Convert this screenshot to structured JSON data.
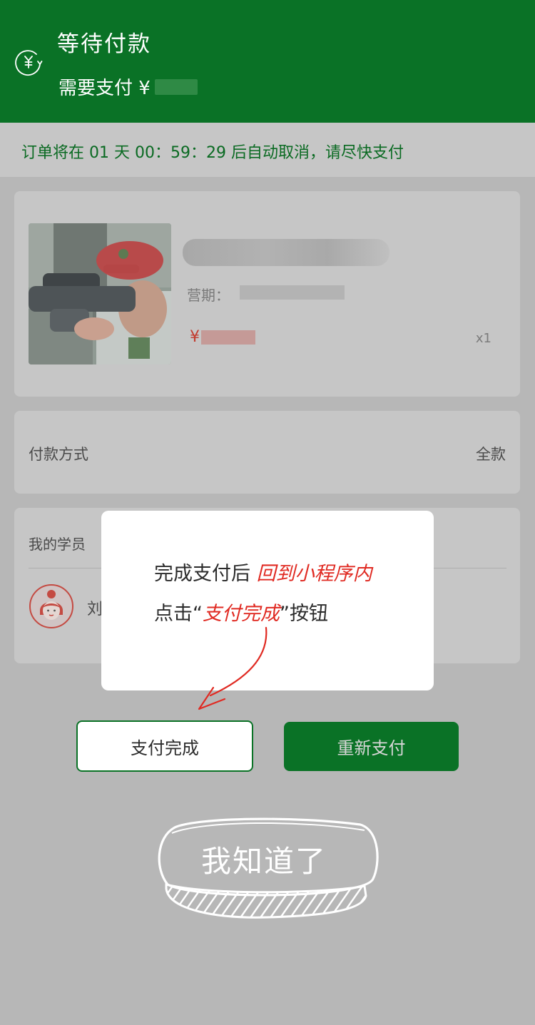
{
  "header": {
    "icon": "yuan-clock-icon",
    "title": "等待付款",
    "amount_label": "需要支付 ¥"
  },
  "notice": {
    "text": "订单将在 01 天 00：59：29 后自动取消，请尽快支付"
  },
  "product": {
    "period_label": "营期：",
    "price_symbol": "¥",
    "quantity": "x1"
  },
  "payment": {
    "label": "付款方式",
    "value": "全款"
  },
  "student": {
    "label": "我的学员",
    "name": "刘"
  },
  "tip": {
    "line1_prefix": "完成支付后 ",
    "line1_highlight": "回到小程序内",
    "line2_prefix": "点击“",
    "line2_highlight": "支付完成",
    "line2_suffix": "”按钮"
  },
  "actions": {
    "done_label": "支付完成",
    "repay_label": "重新支付",
    "got_it_label": "我知道了"
  },
  "colors": {
    "brand_green": "#0a7226",
    "highlight_red": "#e02a22",
    "overlay_gray": "#b7b7b7"
  }
}
